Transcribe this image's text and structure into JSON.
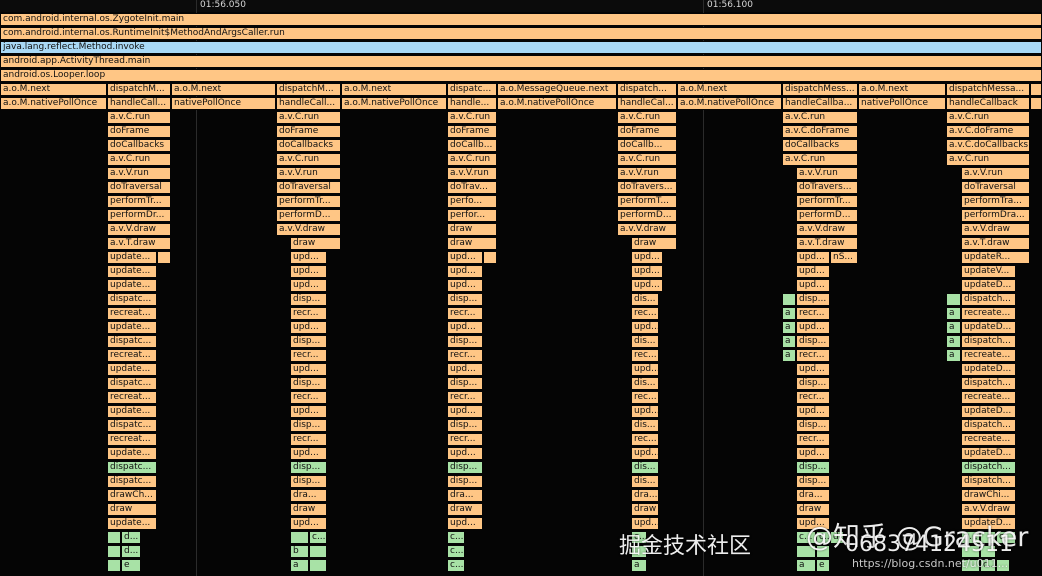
{
  "timeline": {
    "ticks": [
      "01:56.050",
      "01:56.100"
    ]
  },
  "colors": {
    "orange": "#ffc685",
    "blue": "#a9d9f6",
    "green": "#a8e2a6"
  },
  "rows": [
    [
      [
        "com.android.internal.os.ZygoteInit.main"
      ]
    ],
    [
      [
        "com.android.internal.os.RuntimeInit$MethodAndArgsCaller.run"
      ]
    ],
    [
      [
        "java.lang.reflect.Method.invoke",
        "blue"
      ]
    ],
    [
      [
        "android.app.ActivityThread.main"
      ]
    ],
    [
      [
        "android.os.Looper.loop"
      ]
    ],
    [
      [
        "a.o.M.next"
      ],
      [
        "dispatchM..."
      ],
      [
        "a.o.M.next"
      ],
      [
        "dispatchM..."
      ],
      [
        "a.o.M.next"
      ],
      [
        "dispatc..."
      ],
      [
        "a.o.MessageQueue.next"
      ],
      [
        "dispatch..."
      ],
      [
        "a.o.M.next"
      ],
      [
        "dispatchMess..."
      ],
      [
        "a.o.M.next"
      ],
      [
        "dispatchMessa..."
      ],
      [
        ""
      ]
    ],
    [
      [
        "a.o.M.nativePollOnce"
      ],
      [
        "handleCall..."
      ],
      [
        "nativePollOnce"
      ],
      [
        "handleCall..."
      ],
      [
        "a.o.M.nativePollOnce"
      ],
      [
        "handle..."
      ],
      [
        "a.o.M.nativePollOnce"
      ],
      [
        "handleCal..."
      ],
      [
        "a.o.M.nativePollOnce"
      ],
      [
        "handleCallba..."
      ],
      [
        "nativePollOnce"
      ],
      [
        "handleCallback"
      ],
      [
        ""
      ]
    ],
    [
      [
        "a.v.C.run"
      ],
      [
        "a.v.C.run"
      ],
      [
        "a.v.C.run"
      ],
      [
        "a.v.C.run"
      ],
      [
        "a.v.C.run"
      ],
      [
        "a.v.C.run"
      ]
    ],
    [
      [
        "doFrame"
      ],
      [
        "doFrame"
      ],
      [
        "doFrame"
      ],
      [
        "doFrame"
      ],
      [
        "a.v.C.doFrame"
      ],
      [
        "a.v.C.doFrame"
      ]
    ],
    [
      [
        "doCallbacks"
      ],
      [
        "doCallbacks"
      ],
      [
        "doCallb..."
      ],
      [
        "doCallb..."
      ],
      [
        "doCallbacks"
      ],
      [
        "a.v.C.doCallbacks"
      ]
    ],
    [
      [
        "a.v.C.run"
      ],
      [
        "a.v.C.run"
      ],
      [
        "a.v.C.run"
      ],
      [
        "a.v.C.run"
      ],
      [
        "a.v.C.run"
      ],
      [
        "a.v.C.run"
      ]
    ],
    [
      [
        "a.v.V.run"
      ],
      [
        "a.v.V.run"
      ],
      [
        "a.v.V.run"
      ],
      [
        "a.v.V.run"
      ],
      [
        "a.v.V.run"
      ],
      [
        "a.v.V.run"
      ]
    ],
    [
      [
        "doTraversal"
      ],
      [
        "doTraversal"
      ],
      [
        "doTrav..."
      ],
      [
        "doTravers..."
      ],
      [
        "doTravers..."
      ],
      [
        "doTraversal"
      ]
    ],
    [
      [
        "performTr..."
      ],
      [
        "performTr..."
      ],
      [
        "perfo..."
      ],
      [
        "performT..."
      ],
      [
        "performTr..."
      ],
      [
        "performTra..."
      ]
    ],
    [
      [
        "performDr..."
      ],
      [
        "performD..."
      ],
      [
        "perfor..."
      ],
      [
        "performD..."
      ],
      [
        "performD..."
      ],
      [
        "performDra..."
      ]
    ],
    [
      [
        "a.v.V.draw"
      ],
      [
        "a.v.V.draw"
      ],
      [
        "draw"
      ],
      [
        "a.v.V.draw"
      ],
      [
        "a.v.V.draw"
      ],
      [
        "a.v.V.draw"
      ]
    ],
    [
      [
        "a.v.T.draw"
      ],
      [
        "draw"
      ],
      [
        "draw"
      ],
      [
        "draw"
      ],
      [
        "a.v.T.draw"
      ],
      [
        "a.v.T.draw"
      ]
    ],
    [
      [
        "update..."
      ],
      [
        ""
      ],
      [
        "upd..."
      ],
      [
        "upd..."
      ],
      [
        ""
      ],
      [
        "upd..."
      ],
      [
        "upd..."
      ],
      [
        "nS..."
      ],
      [
        "updateR..."
      ]
    ],
    [
      [
        "update..."
      ],
      [
        "upd..."
      ],
      [
        "upd..."
      ],
      [
        "upd..."
      ],
      [
        "upd..."
      ],
      [
        "updateV..."
      ]
    ],
    [
      [
        "update..."
      ],
      [
        "upd..."
      ],
      [
        "upd..."
      ],
      [
        "upd..."
      ],
      [
        "upd..."
      ],
      [
        "updateD..."
      ]
    ],
    [
      [
        "dispatc..."
      ],
      [
        "disp..."
      ],
      [
        "disp..."
      ],
      [
        "dis..."
      ],
      [
        "",
        "green"
      ],
      [
        "disp..."
      ],
      [
        "",
        "green"
      ],
      [
        "dispatch..."
      ]
    ],
    [
      [
        "recreat..."
      ],
      [
        "recr..."
      ],
      [
        "recr..."
      ],
      [
        "rec..."
      ],
      [
        "a",
        "green"
      ],
      [
        "recr..."
      ],
      [
        "a",
        "green"
      ],
      [
        "recreate..."
      ]
    ],
    [
      [
        "update..."
      ],
      [
        "upd..."
      ],
      [
        "upd..."
      ],
      [
        "upd..."
      ],
      [
        "a",
        "green"
      ],
      [
        "upd..."
      ],
      [
        "a",
        "green"
      ],
      [
        "updateD..."
      ]
    ],
    [
      [
        "dispatc..."
      ],
      [
        "disp..."
      ],
      [
        "disp..."
      ],
      [
        "dis..."
      ],
      [
        "a",
        "green"
      ],
      [
        "disp..."
      ],
      [
        "a",
        "green"
      ],
      [
        "dispatch..."
      ]
    ],
    [
      [
        "recreat..."
      ],
      [
        "recr..."
      ],
      [
        "recr..."
      ],
      [
        "rec..."
      ],
      [
        "a",
        "green"
      ],
      [
        "recr..."
      ],
      [
        "a",
        "green"
      ],
      [
        "recreate..."
      ]
    ],
    [
      [
        "update..."
      ],
      [
        "upd..."
      ],
      [
        "upd..."
      ],
      [
        "upd..."
      ],
      [
        "upd..."
      ],
      [
        "updateD..."
      ]
    ],
    [
      [
        "dispatc..."
      ],
      [
        "disp..."
      ],
      [
        "disp..."
      ],
      [
        "dis..."
      ],
      [
        "disp..."
      ],
      [
        "dispatch..."
      ]
    ],
    [
      [
        "recreat..."
      ],
      [
        "recr..."
      ],
      [
        "recr..."
      ],
      [
        "rec..."
      ],
      [
        "recr..."
      ],
      [
        "recreate..."
      ]
    ],
    [
      [
        "update..."
      ],
      [
        "upd..."
      ],
      [
        "upd..."
      ],
      [
        "upd..."
      ],
      [
        "upd..."
      ],
      [
        "updateD..."
      ]
    ],
    [
      [
        "dispatc..."
      ],
      [
        "disp..."
      ],
      [
        "disp..."
      ],
      [
        "dis..."
      ],
      [
        "disp..."
      ],
      [
        "dispatch..."
      ]
    ],
    [
      [
        "recreat..."
      ],
      [
        "recr..."
      ],
      [
        "recr..."
      ],
      [
        "rec..."
      ],
      [
        "recr..."
      ],
      [
        "recreate..."
      ]
    ],
    [
      [
        "update..."
      ],
      [
        "upd..."
      ],
      [
        "upd..."
      ],
      [
        "upd..."
      ],
      [
        "upd..."
      ],
      [
        "updateD..."
      ]
    ],
    [
      [
        "dispatc...",
        "green"
      ],
      [
        "disp...",
        "green"
      ],
      [
        "disp...",
        "green"
      ],
      [
        "dis...",
        "green"
      ],
      [
        "disp...",
        "green"
      ],
      [
        "dispatch...",
        "green"
      ]
    ],
    [
      [
        "dispatc..."
      ],
      [
        "disp..."
      ],
      [
        "disp..."
      ],
      [
        "dis..."
      ],
      [
        "disp..."
      ],
      [
        "dispatch..."
      ]
    ],
    [
      [
        "drawCh..."
      ],
      [
        "dra..."
      ],
      [
        "dra..."
      ],
      [
        "dra..."
      ],
      [
        "dra..."
      ],
      [
        "drawChi..."
      ]
    ],
    [
      [
        "draw"
      ],
      [
        "draw"
      ],
      [
        "draw"
      ],
      [
        "draw"
      ],
      [
        "draw"
      ],
      [
        "a.v.V.draw"
      ]
    ],
    [
      [
        "update..."
      ],
      [
        "upd..."
      ],
      [
        "upd..."
      ],
      [
        "upd..."
      ],
      [
        "upd..."
      ],
      [
        "updateD..."
      ]
    ],
    [
      [
        "",
        "green"
      ],
      [
        "d...",
        "green"
      ],
      [
        "",
        "green"
      ],
      [
        "c...",
        "green"
      ],
      [
        "c...",
        "green"
      ],
      [
        "c...",
        "green"
      ],
      [
        "c...",
        "green"
      ],
      [
        "c...",
        "green"
      ],
      [
        "d...",
        "green"
      ],
      [
        "c...",
        "green"
      ],
      [
        "",
        "green"
      ],
      [
        "c...",
        "green"
      ]
    ],
    [
      [
        "",
        "green"
      ],
      [
        "d...",
        "green"
      ],
      [
        "",
        "green"
      ],
      [
        "b",
        "green"
      ],
      [
        "c...",
        "green"
      ],
      [
        "",
        "green"
      ],
      [
        "",
        "green"
      ],
      [
        "",
        "green"
      ],
      [
        "",
        "green"
      ],
      [
        "",
        "green"
      ]
    ],
    [
      [
        "",
        "green"
      ],
      [
        "e",
        "green"
      ],
      [
        "",
        "green"
      ],
      [
        "a",
        "green"
      ],
      [
        "c...",
        "green"
      ],
      [
        "a",
        "green"
      ],
      [
        "a",
        "green"
      ],
      [
        "e",
        "green"
      ],
      [
        "",
        "green"
      ],
      [
        "c...",
        "green"
      ],
      [
        "",
        "green"
      ]
    ]
  ],
  "watermarks": {
    "juejin": "掘金技术社区",
    "zhihu": "@知乎 @Gracker",
    "number": "068374124511",
    "csdn": "https://blog.csdn.net/u011..."
  }
}
